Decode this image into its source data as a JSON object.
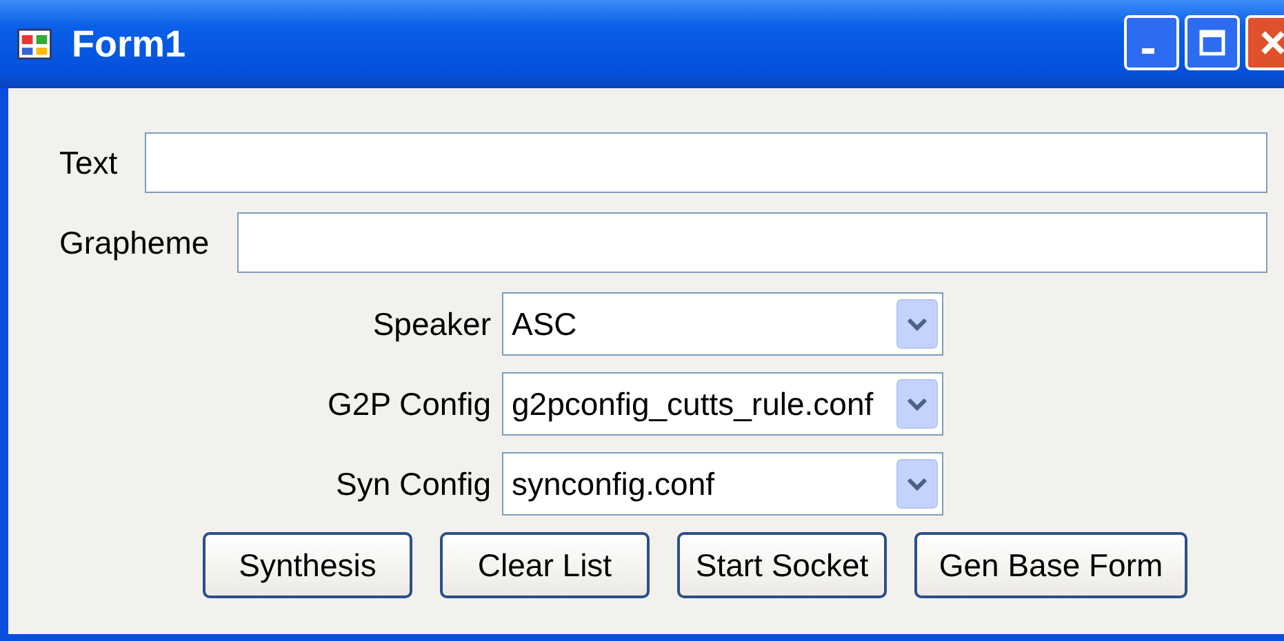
{
  "window": {
    "title": "Form1"
  },
  "text_fields": [
    {
      "label": "Text"
    },
    {
      "label": "Grapheme"
    }
  ],
  "combos": [
    {
      "label": "Speaker",
      "value": "ASC"
    },
    {
      "label": "G2P Config",
      "value": "g2pconfig_cutts_rule.conf"
    },
    {
      "label": "Syn Config",
      "value": "synconfig.conf"
    }
  ],
  "buttons": [
    "Synthesis",
    "Clear List",
    "Start Socket",
    "Gen Base Form"
  ]
}
